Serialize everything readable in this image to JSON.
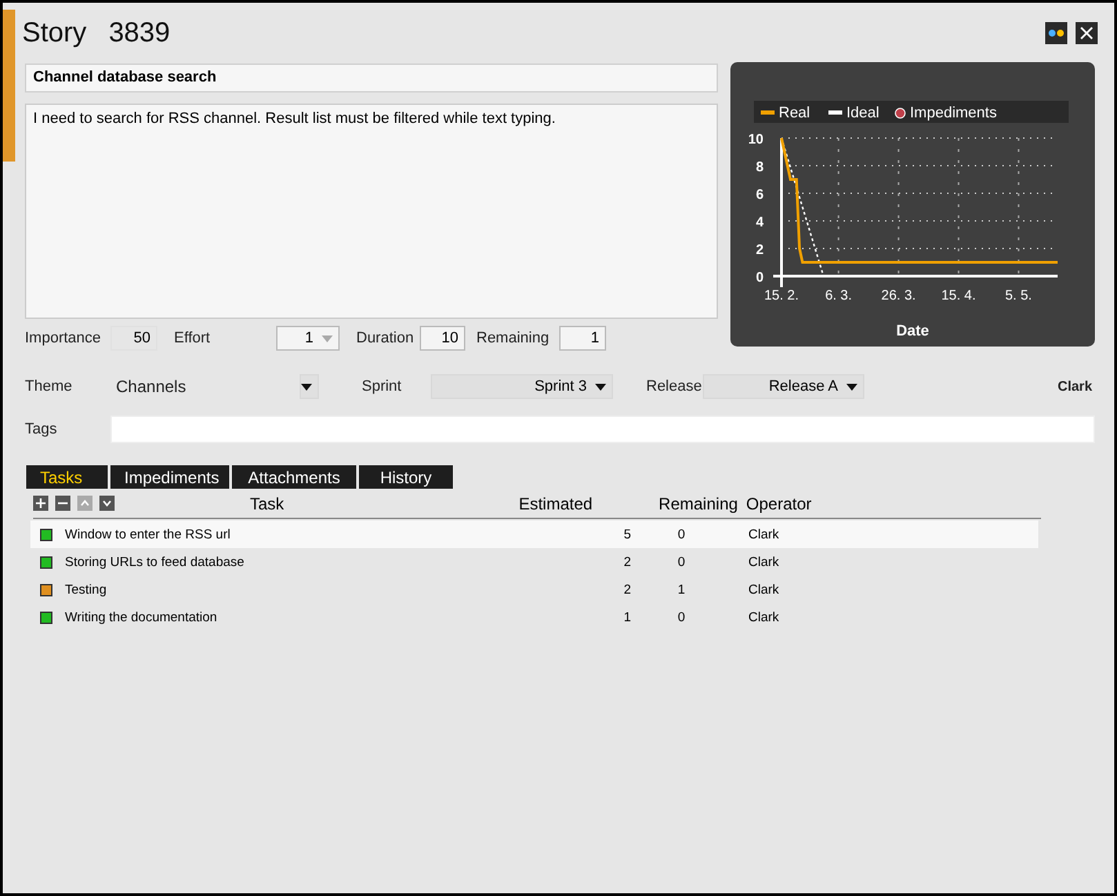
{
  "window": {
    "title": "Story",
    "number": "3839"
  },
  "summary": {
    "value": "Channel database search"
  },
  "description": {
    "value": "I need to search for RSS channel. Result list must be filtered while text typing."
  },
  "chart": {
    "chart_data": {
      "type": "line",
      "xlabel": "Date",
      "categories": [
        "15. 2.",
        null,
        null,
        null,
        null,
        null,
        null,
        null,
        null,
        null,
        null,
        null,
        null,
        null,
        null,
        null,
        null,
        null,
        null,
        "6. 3.",
        null,
        null,
        null,
        null,
        null,
        null,
        null,
        null,
        null,
        null,
        null,
        null,
        null,
        null,
        null,
        null,
        null,
        null,
        null,
        "26. 3.",
        null,
        null,
        null,
        null,
        null,
        null,
        null,
        null,
        null,
        null,
        null,
        null,
        null,
        null,
        null,
        null,
        null,
        null,
        null,
        "15. 4.",
        null,
        null,
        null,
        null,
        null,
        null,
        null,
        null,
        null,
        null,
        null,
        null,
        null,
        null,
        null,
        null,
        null,
        null,
        null,
        "5. 5.",
        null,
        null,
        null,
        null,
        null,
        null,
        null,
        null,
        null,
        null,
        null,
        null,
        null
      ],
      "grid": true,
      "legend": "top",
      "series": [
        {
          "name": "Real",
          "color": "#f0a000",
          "line_style": "solid",
          "values": [
            10,
            9,
            8,
            7,
            7,
            7,
            2,
            1,
            1,
            1,
            1,
            1,
            1,
            1,
            1,
            1,
            1,
            1,
            1,
            1,
            1,
            1,
            1,
            1,
            1,
            1,
            1,
            1,
            1,
            1,
            1,
            1,
            1,
            1,
            1,
            1,
            1,
            1,
            1,
            1,
            1,
            1,
            1,
            1,
            1,
            1,
            1,
            1,
            1,
            1,
            1,
            1,
            1,
            1,
            1,
            1,
            1,
            1,
            1,
            1,
            1,
            1,
            1,
            1,
            1,
            1,
            1,
            1,
            1,
            1,
            1,
            1,
            1,
            1,
            1,
            1,
            1,
            1,
            1,
            1,
            1,
            1,
            1,
            1,
            1,
            1,
            1,
            1,
            1,
            1,
            1,
            1,
            1
          ]
        },
        {
          "name": "Ideal",
          "color": "#ffffff",
          "line_style": "dashed",
          "values": [
            10,
            null,
            null,
            null,
            null,
            null,
            null,
            null,
            null,
            null,
            null,
            null,
            null,
            null,
            0,
            null,
            null,
            null,
            null,
            null,
            null,
            null,
            null,
            null,
            null,
            null,
            null,
            null,
            null,
            null,
            null,
            null,
            null,
            null,
            null,
            null,
            null,
            null,
            null,
            null,
            null,
            null,
            null,
            null,
            null,
            null,
            null,
            null,
            null,
            null,
            null,
            null,
            null,
            null,
            null,
            null,
            null,
            null,
            null,
            null,
            null,
            null,
            null,
            null,
            null,
            null,
            null,
            null,
            null,
            null,
            null,
            null,
            null,
            null,
            null,
            null,
            null,
            null,
            null,
            null,
            null,
            null,
            null,
            null,
            null,
            null,
            null,
            null,
            null,
            null,
            null,
            null,
            null
          ]
        },
        {
          "name": "Impediments",
          "color": "#c0404a",
          "values": [
            null,
            null,
            null,
            null,
            null,
            null,
            null,
            null,
            null,
            null,
            null,
            null,
            null,
            null,
            null,
            null,
            null,
            null,
            null,
            null,
            null,
            null,
            null,
            null,
            null,
            null,
            null,
            null,
            null,
            null,
            null,
            null,
            null,
            null,
            null,
            null,
            null,
            null,
            null,
            null,
            null,
            null,
            null,
            null,
            null,
            null,
            null,
            null,
            null,
            null,
            null,
            null,
            null,
            null,
            null,
            null,
            null,
            null,
            null,
            null,
            null,
            null,
            null,
            null,
            null,
            null,
            null,
            null,
            null,
            null,
            null,
            null,
            null,
            null,
            null,
            null,
            null,
            null,
            null,
            null,
            null,
            null,
            null,
            null,
            null,
            null,
            null,
            null,
            null,
            null,
            null,
            null,
            null
          ]
        }
      ],
      "ylim": [
        0,
        10
      ],
      "yticks": [
        0,
        2,
        4,
        6,
        8,
        10
      ]
    }
  },
  "metrics": [
    {
      "label": "Importance",
      "value": "50",
      "kind": "readonly"
    },
    {
      "label": "Effort",
      "value": "1",
      "kind": "dropdown"
    },
    {
      "label": "Duration",
      "value": "10",
      "kind": "input"
    },
    {
      "label": "Remaining",
      "value": "1",
      "kind": "input"
    }
  ],
  "theme": {
    "label": "Theme",
    "value": "Channels"
  },
  "sprint": {
    "label": "Sprint",
    "value": "Sprint 3"
  },
  "release": {
    "label": "Release",
    "value": "Release A"
  },
  "owner": "Clark",
  "tags": {
    "label": "Tags"
  },
  "tabs": [
    {
      "label": "Tasks",
      "selected": true
    },
    {
      "label": "Impediments",
      "selected": false
    },
    {
      "label": "Attachments",
      "selected": false
    },
    {
      "label": "History",
      "selected": false
    }
  ],
  "toolbar": [
    {
      "kind": "add",
      "disabled": false
    },
    {
      "kind": "remove",
      "disabled": false
    },
    {
      "kind": "up",
      "disabled": true
    },
    {
      "kind": "down",
      "disabled": false
    }
  ],
  "columns": [
    "Task",
    "Estimated",
    "Remaining",
    "Operator"
  ],
  "tasks": [
    {
      "name": "Window to enter the RSS url",
      "estimated": "5",
      "remaining": "0",
      "operator": "Clark",
      "color": "#22bb22",
      "selected": true
    },
    {
      "name": "Storing URLs to feed database",
      "estimated": "2",
      "remaining": "0",
      "operator": "Clark",
      "color": "#22bb22",
      "selected": false
    },
    {
      "name": "Testing",
      "estimated": "2",
      "remaining": "1",
      "operator": "Clark",
      "color": "#e09020",
      "selected": false
    },
    {
      "name": "Writing the documentation",
      "estimated": "1",
      "remaining": "0",
      "operator": "Clark",
      "color": "#22bb22",
      "selected": false
    }
  ]
}
